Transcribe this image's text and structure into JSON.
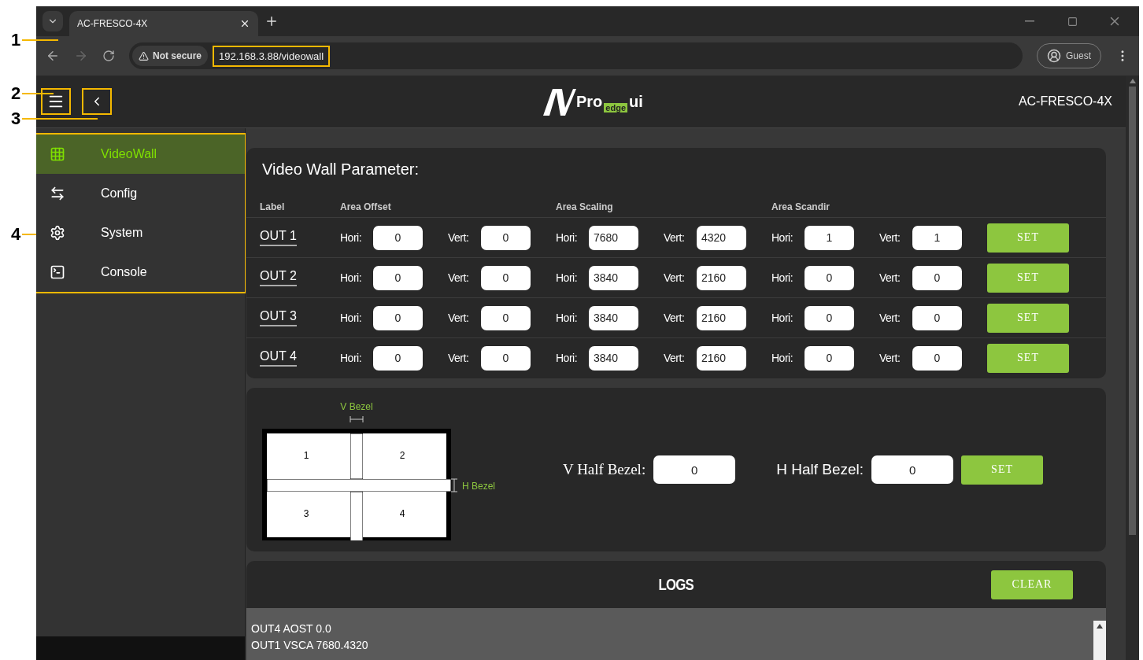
{
  "callouts": [
    {
      "label": "1"
    },
    {
      "label": "2"
    },
    {
      "label": "3"
    },
    {
      "label": "4"
    }
  ],
  "browser": {
    "tab_title": "AC-FRESCO-4X",
    "security": "Not secure",
    "url": "192.168.3.88/videowall",
    "profile": "Guest"
  },
  "app_header": {
    "logo_text": "Pro",
    "logo_badge": "edge",
    "logo_suffix": "ui",
    "device": "AC-FRESCO-4X"
  },
  "sidebar": {
    "items": [
      {
        "label": "VideoWall",
        "selected": true
      },
      {
        "label": "Config",
        "selected": false
      },
      {
        "label": "System",
        "selected": false
      },
      {
        "label": "Console",
        "selected": false
      }
    ]
  },
  "video_wall": {
    "title": "Video Wall Parameter:",
    "columns": [
      "Label",
      "Area Offset",
      "Area Scaling",
      "Area Scandir"
    ],
    "rows": [
      {
        "label": "OUT 1",
        "button": "SET",
        "fields": [
          {
            "label": "Hori:",
            "value": "0"
          },
          {
            "label": "Vert:",
            "value": "0"
          },
          {
            "label": "Hori:",
            "value": "7680"
          },
          {
            "label": "Vert:",
            "value": "4320"
          },
          {
            "label": "Hori:",
            "value": "1"
          },
          {
            "label": "Vert:",
            "value": "1"
          }
        ]
      },
      {
        "label": "OUT 2",
        "button": "SET",
        "fields": [
          {
            "label": "Hori:",
            "value": "0"
          },
          {
            "label": "Vert:",
            "value": "0"
          },
          {
            "label": "Hori:",
            "value": "3840"
          },
          {
            "label": "Vert:",
            "value": "2160"
          },
          {
            "label": "Hori:",
            "value": "0"
          },
          {
            "label": "Vert:",
            "value": "0"
          }
        ]
      },
      {
        "label": "OUT 3",
        "button": "SET",
        "fields": [
          {
            "label": "Hori:",
            "value": "0"
          },
          {
            "label": "Vert:",
            "value": "0"
          },
          {
            "label": "Hori:",
            "value": "3840"
          },
          {
            "label": "Vert:",
            "value": "2160"
          },
          {
            "label": "Hori:",
            "value": "0"
          },
          {
            "label": "Vert:",
            "value": "0"
          }
        ]
      },
      {
        "label": "OUT 4",
        "button": "SET",
        "fields": [
          {
            "label": "Hori:",
            "value": "0"
          },
          {
            "label": "Vert:",
            "value": "0"
          },
          {
            "label": "Hori:",
            "value": "3840"
          },
          {
            "label": "Vert:",
            "value": "2160"
          },
          {
            "label": "Hori:",
            "value": "0"
          },
          {
            "label": "Vert:",
            "value": "0"
          }
        ]
      }
    ]
  },
  "bezel": {
    "v_bezel_label": "V Bezel",
    "h_bezel_label": "H Bezel",
    "screens": [
      "1",
      "2",
      "3",
      "4"
    ],
    "v_half_label": "V Half Bezel:",
    "v_half_value": "0",
    "h_half_label": "H Half Bezel:",
    "h_half_value": "0",
    "button": "SET"
  },
  "logs": {
    "title": "LOGS",
    "button": "CLEAR",
    "lines": [
      "OUT4 AOST 0.0",
      "OUT1 VSCA 7680.4320"
    ]
  }
}
